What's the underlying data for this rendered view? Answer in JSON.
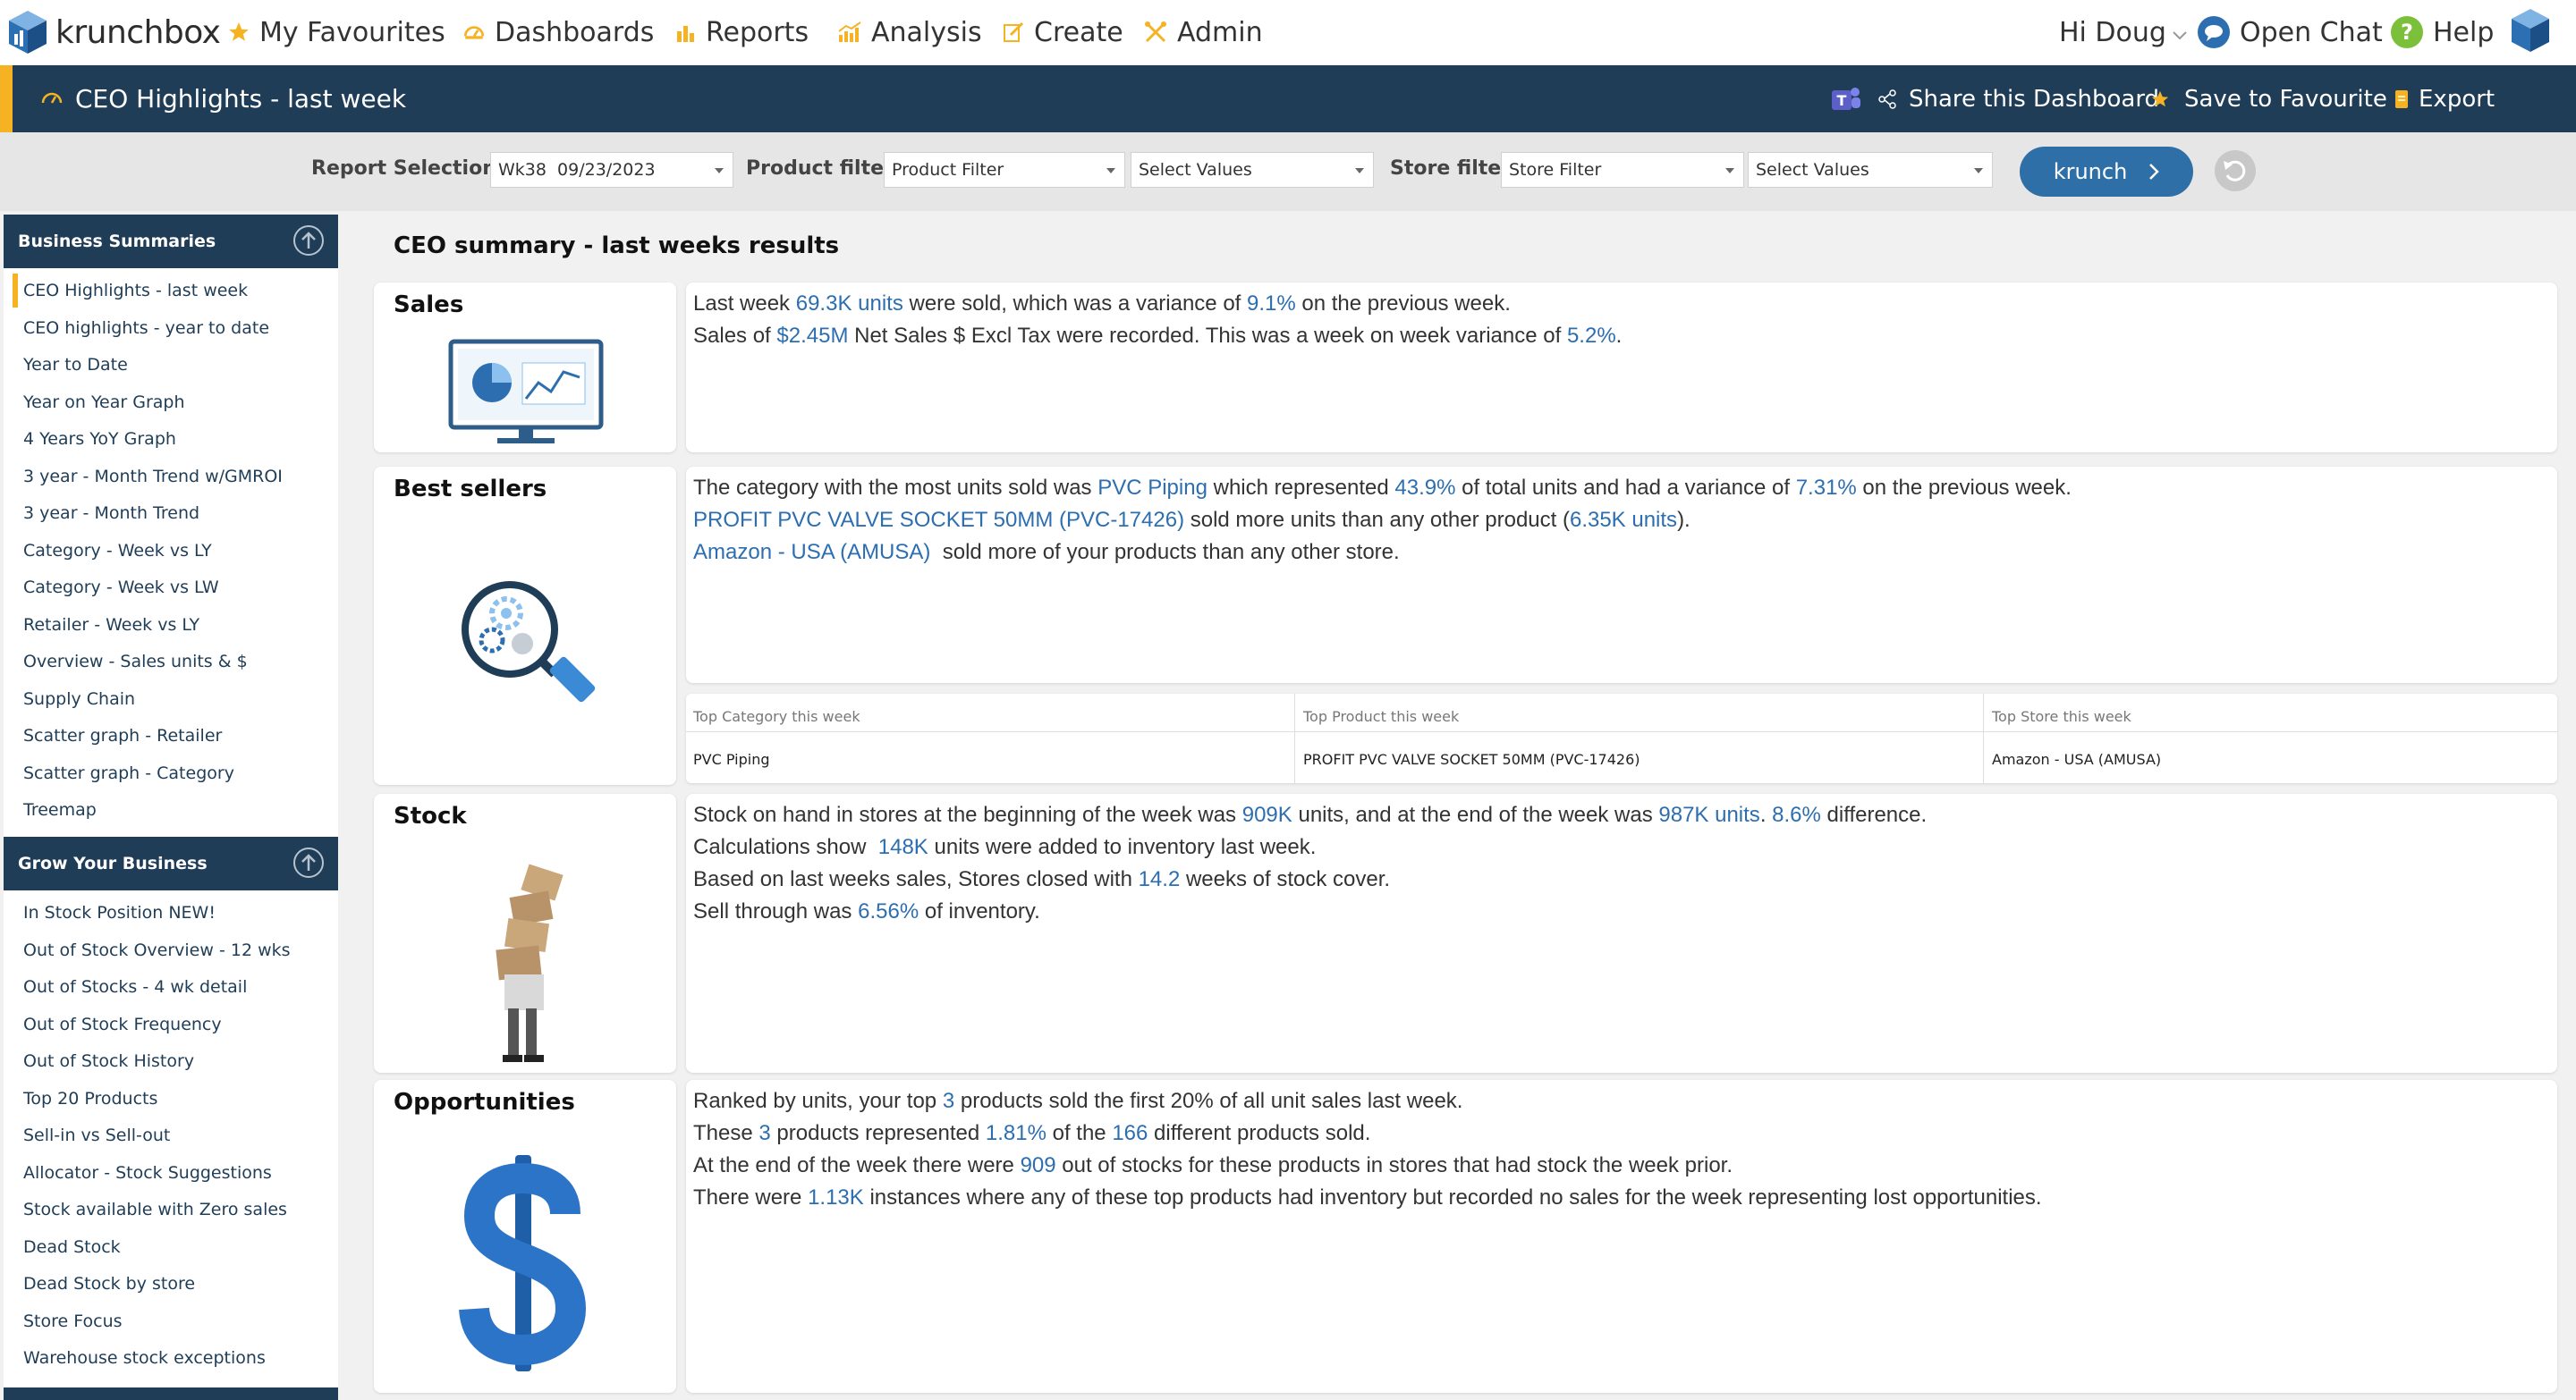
{
  "nav": {
    "brand": "krunchbox",
    "items": [
      {
        "label": "My Favourites",
        "icon": "star-icon"
      },
      {
        "label": "Dashboards",
        "icon": "dashboard-icon"
      },
      {
        "label": "Reports",
        "icon": "bar-chart-icon"
      },
      {
        "label": "Analysis",
        "icon": "analysis-icon"
      },
      {
        "label": "Create",
        "icon": "edit-icon"
      },
      {
        "label": "Admin",
        "icon": "tools-icon"
      }
    ],
    "greeting": "Hi Doug",
    "open_chat": "Open Chat",
    "help": "Help"
  },
  "titlebar": {
    "title": "CEO Highlights - last week",
    "share": "Share this Dashboard",
    "save": "Save to Favourite",
    "export": "Export"
  },
  "filters": {
    "report_label": "Report Selection:",
    "report_value": "Wk38  09/23/2023",
    "product_label": "Product filter:",
    "product_filter": "Product Filter",
    "product_values": "Select Values",
    "store_label": "Store filter:",
    "store_filter": "Store Filter",
    "store_values": "Select Values",
    "krunch": "krunch"
  },
  "sidebar": {
    "section1": "Business Summaries",
    "items1": [
      "CEO Highlights - last week",
      "CEO highlights - year to date",
      "Year to Date",
      "Year on Year Graph",
      "4 Years YoY Graph",
      "3 year - Month Trend w/GMROI",
      "3 year - Month Trend",
      "Category - Week vs LY",
      "Category - Week vs LW",
      "Retailer - Week vs LY",
      "Overview - Sales units & $",
      "Supply Chain",
      "Scatter graph - Retailer",
      "Scatter graph - Category",
      "Treemap"
    ],
    "section2": "Grow Your Business",
    "items2": [
      "In Stock Position NEW!",
      "Out of Stock Overview - 12 wks",
      "Out of Stocks - 4 wk detail",
      "Out of Stock Frequency",
      "Out of Stock History",
      "Top 20 Products",
      "Sell-in vs Sell-out",
      "Allocator - Stock Suggestions",
      "Stock available with Zero sales",
      "Dead Stock",
      "Dead Stock by store",
      "Store Focus",
      "Warehouse stock exceptions"
    ]
  },
  "content": {
    "title": "CEO summary - last weeks results",
    "sales": {
      "heading": "Sales",
      "l1a": "Last week ",
      "l1v1": "69.3K units",
      "l1b": " were sold, which was a variance of ",
      "l1v2": "9.1%",
      "l1c": " on the previous week.",
      "l2a": "Sales of ",
      "l2v1": "$2.45M",
      "l2b": " Net Sales $ Excl Tax were recorded. This was a week on week variance of ",
      "l2v2": "5.2%",
      "l2c": "."
    },
    "best": {
      "heading": "Best sellers",
      "l1a": "The category with the most units sold was ",
      "l1v1": "PVC Piping",
      "l1b": " which represented ",
      "l1v2": "43.9%",
      "l1c": " of total units and had a variance of ",
      "l1v3": "7.31%",
      "l1d": " on the previous week.",
      "l2v1": "PROFIT PVC VALVE SOCKET 50MM (PVC-17426)",
      "l2a": " sold more units than any other product (",
      "l2v2": "6.35K units",
      "l2b": ").",
      "l3v1": "Amazon - USA (AMUSA)",
      "l3a": "  sold more of your products than any other store.",
      "table": {
        "headers": [
          "Top Category this week",
          "Top Product this week",
          "Top Store this week"
        ],
        "row": [
          "PVC Piping",
          "PROFIT PVC VALVE SOCKET 50MM (PVC-17426)",
          "Amazon - USA (AMUSA)"
        ]
      }
    },
    "stock": {
      "heading": "Stock",
      "l1a": "Stock on hand in stores at the beginning of the week was ",
      "l1v1": "909K",
      "l1b": " units, and at the end of the week was ",
      "l1v2": "987K units",
      "l1c": ". ",
      "l1v3": "8.6%",
      "l1d": " difference.",
      "l2a": "Calculations show  ",
      "l2v1": "148K",
      "l2b": " units were added to inventory last week.",
      "l3a": "Based on last weeks sales, Stores closed with ",
      "l3v1": "14.2",
      "l3b": " weeks of stock cover.",
      "l4a": "Sell through was ",
      "l4v1": "6.56%",
      "l4b": " of inventory."
    },
    "opp": {
      "heading": "Opportunities",
      "l1a": "Ranked by units, your top ",
      "l1v1": "3",
      "l1b": " products sold the first 20% of all unit sales last week.",
      "l2a": "These ",
      "l2v1": "3",
      "l2b": " products represented ",
      "l2v2": "1.81%",
      "l2c": " of the ",
      "l2v3": "166",
      "l2d": " different products sold.",
      "l3a": "At the end of the week there were ",
      "l3v1": "909",
      "l3b": " out of stocks for these products in stores that had stock the week prior.",
      "l4a": "There were ",
      "l4v1": "1.13K",
      "l4b": " instances where any of these top products had inventory but recorded no sales for the week representing lost opportunities."
    }
  },
  "colors": {
    "nav_dark": "#1f3d57",
    "accent": "#f5b324",
    "value_blue": "#2c6eb0",
    "button_blue": "#2f6fa8"
  }
}
